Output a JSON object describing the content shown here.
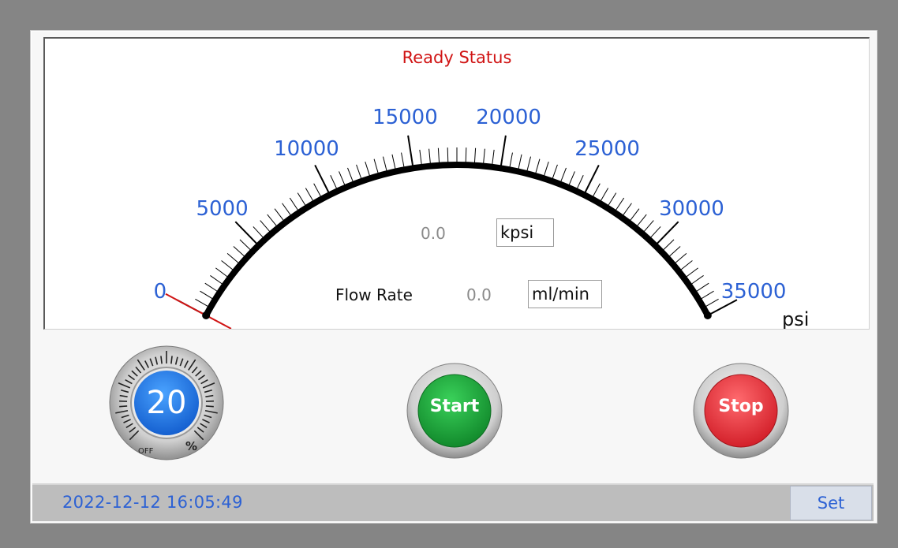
{
  "status": {
    "title": "Ready Status",
    "color": "#d01414"
  },
  "gauge": {
    "scale_labels": [
      "0",
      "5000",
      "10000",
      "15000",
      "20000",
      "25000",
      "30000",
      "35000"
    ],
    "unit": "psi",
    "pressure_value": "0.0",
    "pressure_unit": "kpsi",
    "flow_label": "Flow Rate",
    "flow_value": "0.0",
    "flow_unit": "ml/min",
    "label_color": "#2c61d4",
    "needle_color": "#d01414",
    "needle_value_psi": 0
  },
  "knob": {
    "value": "20",
    "off_label": "OFF",
    "percent_label": "%",
    "icon": "speed-knob-icon"
  },
  "buttons": {
    "start_label": "Start",
    "start_color": "#1fa33c",
    "stop_label": "Stop",
    "stop_color": "#e0393e"
  },
  "footer": {
    "datetime": "2022-12-12  16:05:49",
    "set_label": "Set"
  }
}
